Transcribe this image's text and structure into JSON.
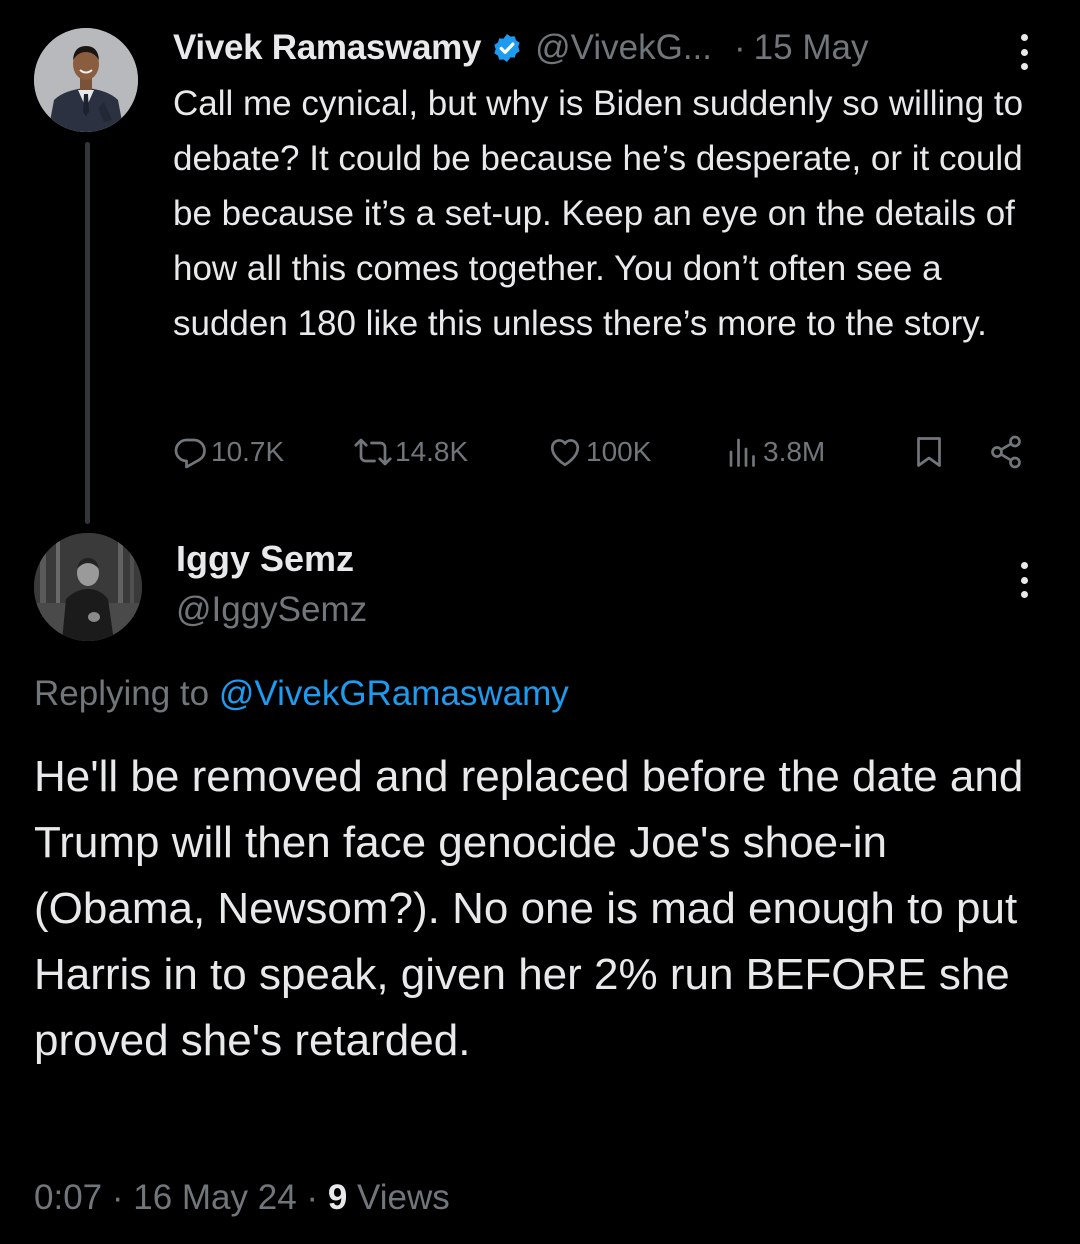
{
  "parent_tweet": {
    "author_name": "Vivek Ramaswamy",
    "handle": "@VivekG...",
    "separator": "·",
    "date": "15 May",
    "text": "Call me cynical, but why is Biden suddenly so willing to debate? It could be because he’s desperate, or it could be because it’s a set-up. Keep an eye on the details of how all this comes together. You don’t often see a sudden 180 like this unless there’s more to the story.",
    "metrics": {
      "replies": "10.7K",
      "reposts": "14.8K",
      "likes": "100K",
      "views": "3.8M"
    },
    "icons": {
      "verified": "verified-badge-icon",
      "more": "more-options-icon",
      "reply": "reply-icon",
      "repost": "repost-icon",
      "like": "like-icon",
      "views": "views-icon",
      "bookmark": "bookmark-icon",
      "share": "share-icon"
    }
  },
  "reply_tweet": {
    "author_name": "Iggy Semz",
    "handle": "@IggySemz",
    "replying_prefix": "Replying to",
    "replying_to": "@VivekGRamaswamy",
    "text": "He'll be removed and replaced before the date and Trump will then face genocide Joe's shoe-in (Obama, Newsom?). No one is mad enough to put Harris in to speak, given her 2% run BEFORE she proved she's retarded.",
    "time": "0:07",
    "separator": "·",
    "date": "16 May 24",
    "views_count": "9",
    "views_label": "Views"
  },
  "colors": {
    "background": "#000000",
    "primary_text": "#e7e9ea",
    "secondary_text": "#71767b",
    "accent": "#1d9bf0",
    "thread_line": "#333639"
  }
}
